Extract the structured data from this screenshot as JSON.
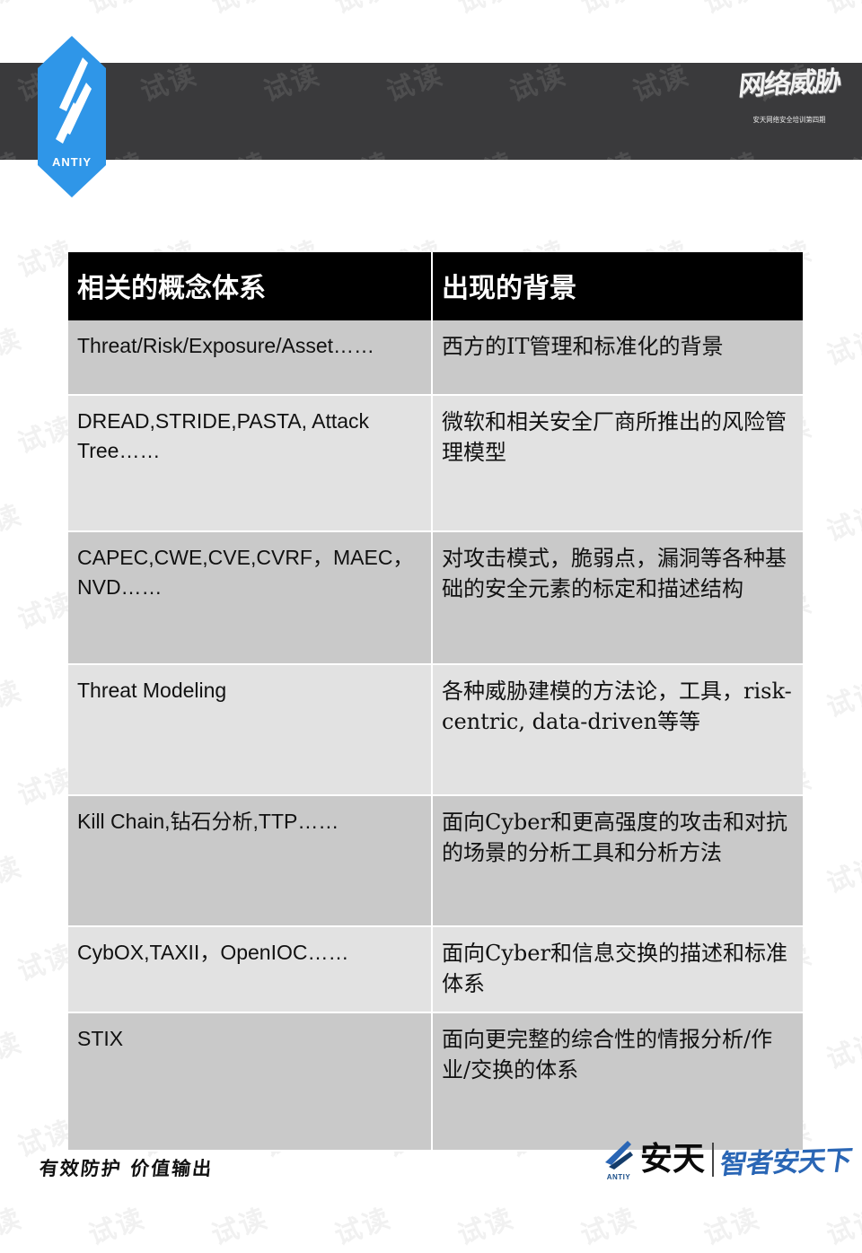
{
  "header": {
    "brand_logo_word": "ANTIY",
    "course_title": "网络威胁",
    "course_subtitle": "安天网络安全培训第四期",
    "band_color": "#3a3a3c",
    "logo_color": "#2f96e8"
  },
  "watermark": {
    "text": "试读"
  },
  "table": {
    "columns": [
      "相关的概念体系",
      "出现的背景"
    ],
    "rows": [
      {
        "concept": "Threat/Risk/Exposure/Asset……",
        "background": "西方的IT管理和标准化的背景"
      },
      {
        "concept": "DREAD,STRIDE,PASTA, Attack Tree……",
        "background": "微软和相关安全厂商所推出的风险管理模型"
      },
      {
        "concept": "CAPEC,CWE,CVE,CVRF，MAEC，NVD……",
        "background": "对攻击模式，脆弱点，漏洞等各种基础的安全元素的标定和描述结构"
      },
      {
        "concept": "Threat Modeling",
        "background": "各种威胁建模的方法论，工具，risk-centric, data-driven等等"
      },
      {
        "concept": "Kill Chain,钻石分析,TTP……",
        "background": "面向Cyber和更高强度的攻击和对抗的场景的分析工具和分析方法"
      },
      {
        "concept": "CybOX,TAXII，OpenIOC……",
        "background": "面向Cyber和信息交换的描述和标准体系"
      },
      {
        "concept": "STIX",
        "background": "面向更完整的综合性的情报分析/作业/交换的体系"
      }
    ]
  },
  "footer": {
    "slogan": "有效防护 价值输出",
    "logo_word": "ANTIY",
    "company_name": "安天",
    "tagline": "智者安天下"
  }
}
